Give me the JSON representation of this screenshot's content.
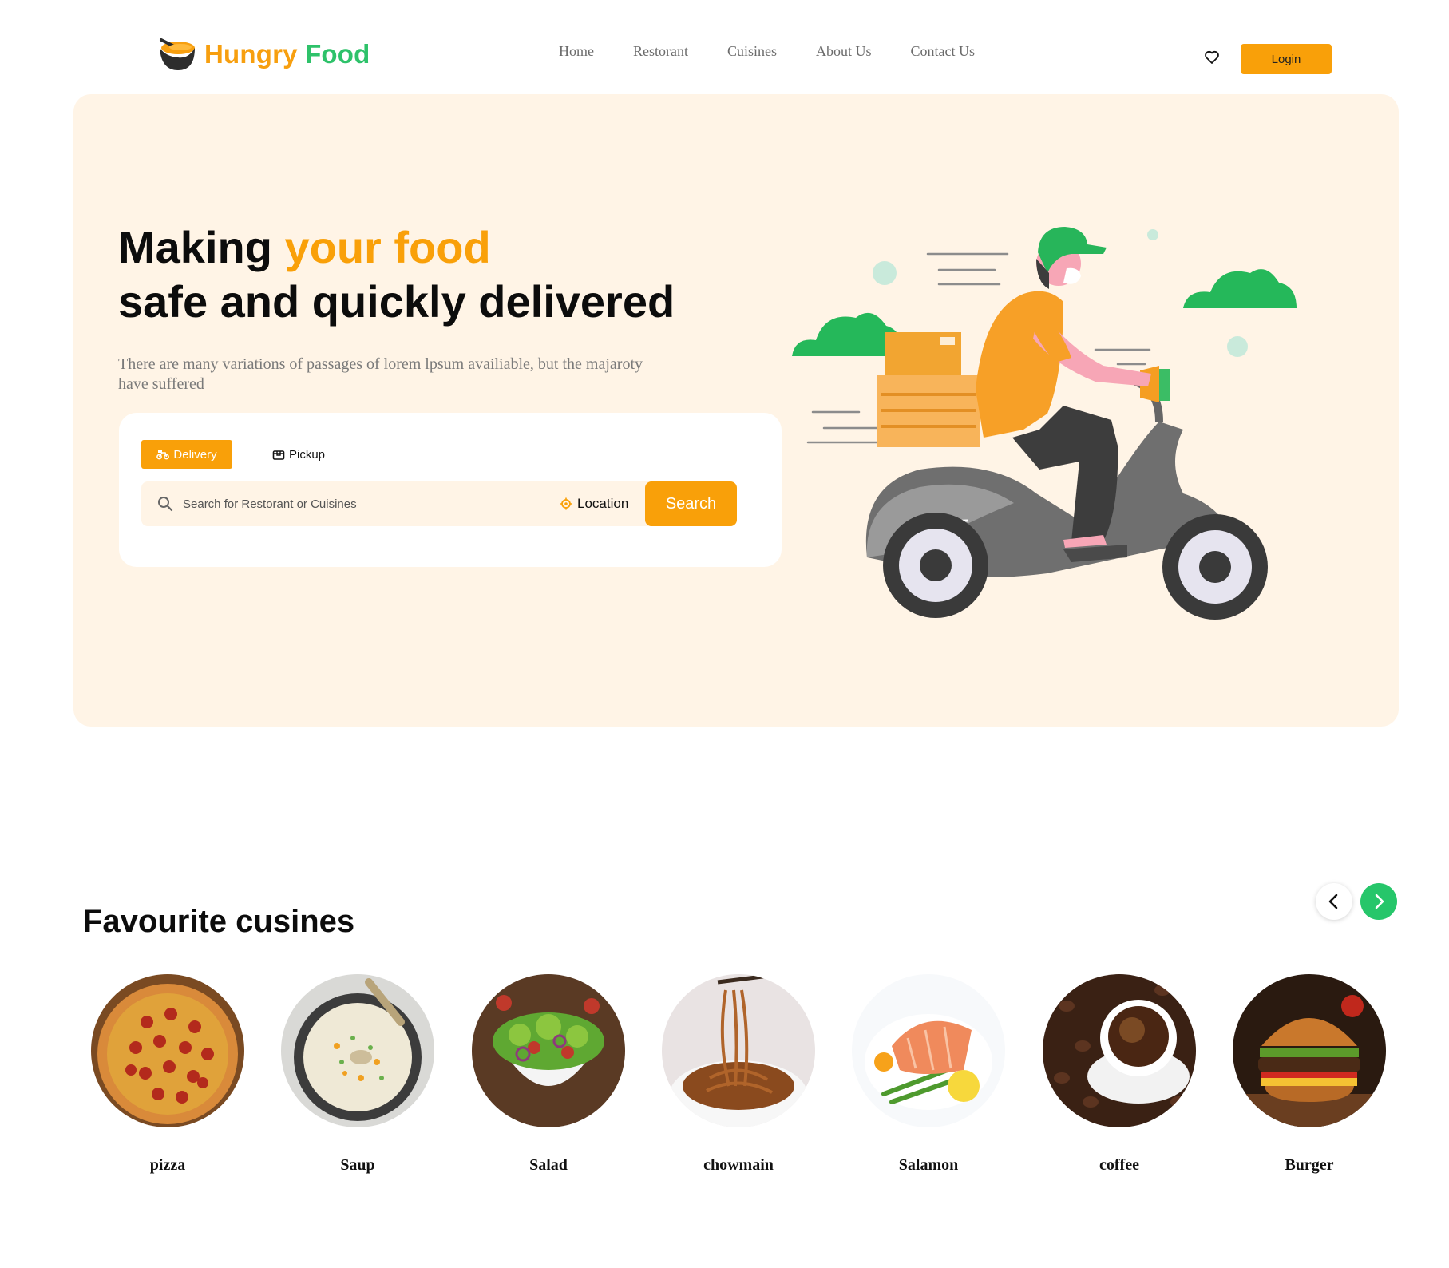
{
  "header": {
    "logo_word1": "Hungry",
    "logo_word2": "Food",
    "nav": [
      "Home",
      "Restorant",
      "Cuisines",
      "About Us",
      "Contact Us"
    ],
    "login_label": "Login"
  },
  "hero": {
    "title_line1_start": "Making ",
    "title_line1_accent": "your food",
    "title_line2": "safe and quickly delivered",
    "description": "There are many variations of passages of lorem lpsum availiable, but the majaroty have suffered",
    "tabs": [
      "Delivery",
      "Pickup"
    ],
    "search_placeholder": "Search for Restorant or Cuisines",
    "location_label": "Location",
    "search_button": "Search"
  },
  "cuisines": {
    "title": "Favourite cusines",
    "items": [
      "pizza",
      "Saup",
      "Salad",
      "chowmain",
      "Salamon",
      "coffee",
      "Burger"
    ]
  },
  "colors": {
    "accent_orange": "#f9a009",
    "accent_green": "#26c66a",
    "hero_background": "#fff4e6"
  },
  "icons": {
    "logo": "bowl-icon",
    "favourite": "heart-icon",
    "delivery_tab": "scooter-icon",
    "pickup_tab": "package-icon",
    "search": "search-icon",
    "location": "location-target-icon",
    "prev": "chevron-left-icon",
    "next": "chevron-right-icon"
  }
}
